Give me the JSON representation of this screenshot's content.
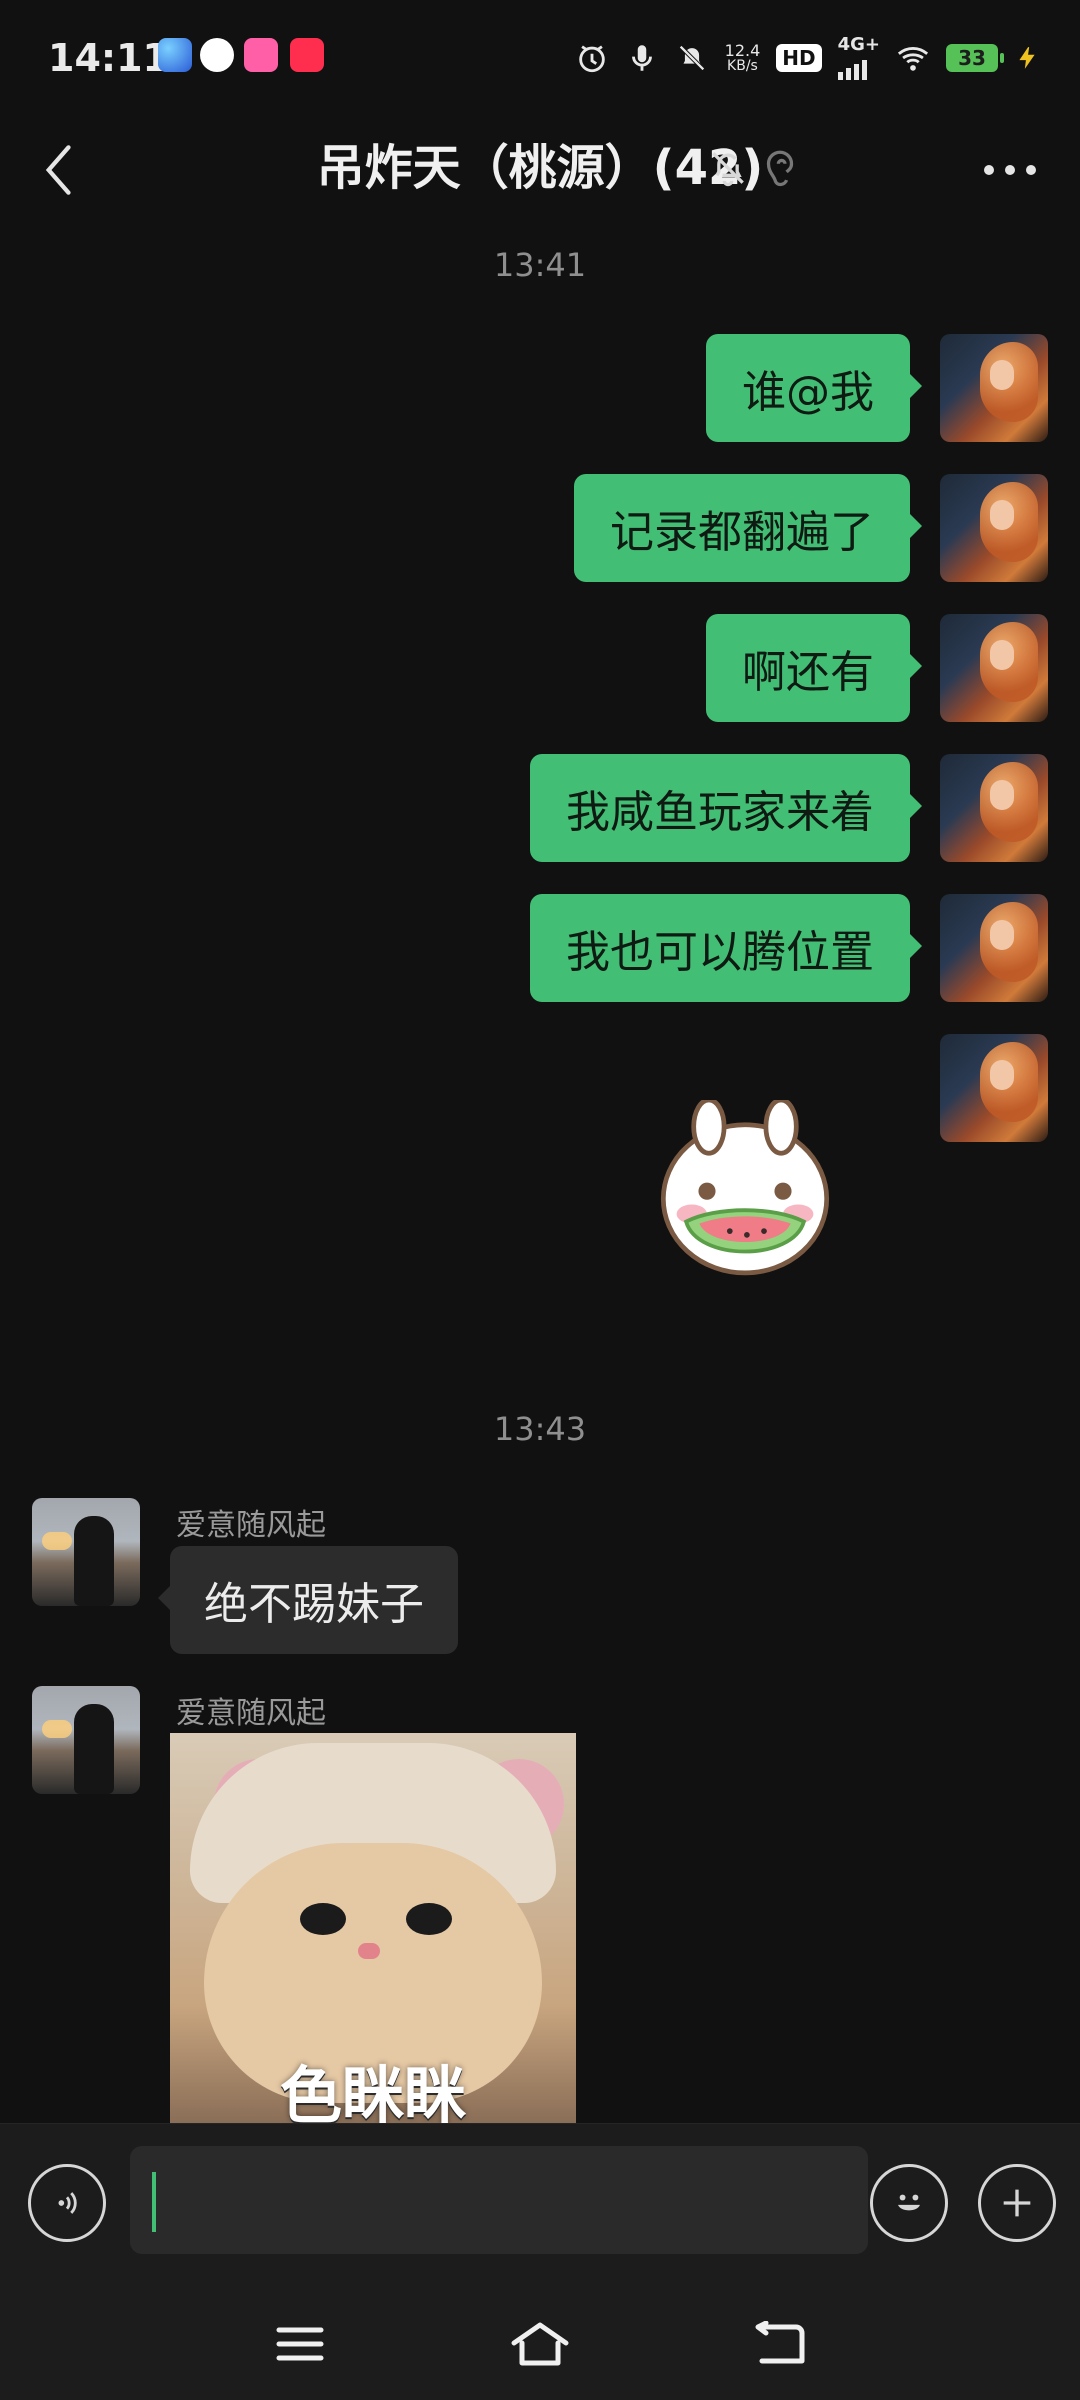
{
  "status_bar": {
    "time": "14:11",
    "network_speed_value": "12.4",
    "network_speed_unit": "KB/s",
    "hd_label": "HD",
    "network_type": "4G+",
    "battery": "33"
  },
  "header": {
    "title": "吊炸天（桃源）(42)"
  },
  "timestamps": [
    "13:41",
    "13:43"
  ],
  "messages_self": [
    {
      "text": "谁@我"
    },
    {
      "text": "记录都翻遍了"
    },
    {
      "text": "啊还有"
    },
    {
      "text": "我咸鱼玩家来着"
    },
    {
      "text": "我也可以腾位置"
    }
  ],
  "messages_other": [
    {
      "sender": "爱意随风起",
      "text": "绝不踢妹子"
    },
    {
      "sender": "爱意随风起",
      "image_caption": "色眯眯"
    }
  ],
  "icons": {
    "back": "chevron-left-icon",
    "mute": "bell-off-icon",
    "ear": "ear-icon",
    "more": "more-horizontal-icon",
    "voice": "voice-icon",
    "emoji": "smile-icon",
    "plus": "plus-icon",
    "nav_menu": "menu-icon",
    "nav_home": "home-icon",
    "nav_back": "back-icon"
  },
  "colors": {
    "accent_green": "#43bf75",
    "background": "#111111",
    "bubble_dark": "#2c2c2c"
  }
}
